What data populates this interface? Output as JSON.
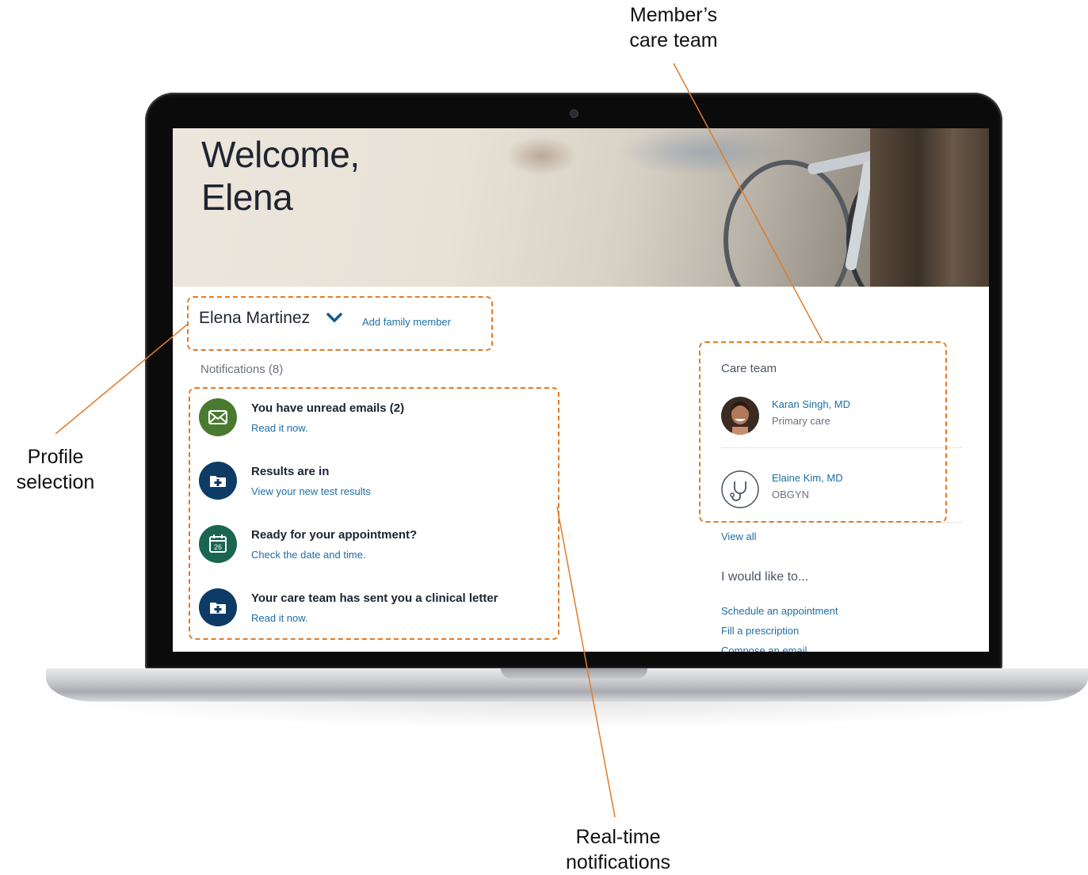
{
  "callouts": {
    "care_team": [
      "Member’s",
      "care team"
    ],
    "profile": [
      "Profile",
      "selection"
    ],
    "notifications": [
      "Real-time",
      "notifications"
    ]
  },
  "hero": {
    "welcome_line1": "Welcome,",
    "welcome_line2": "Elena"
  },
  "profile": {
    "name": "Elena Martinez",
    "add_family_label": "Add family member"
  },
  "notifications": {
    "header": "Notifications (8)",
    "items": [
      {
        "title": "You have unread emails (2)",
        "link": "Read it now.",
        "icon": "mail-icon",
        "color": "#4a7a2f"
      },
      {
        "title": "Results are in",
        "link": "View your new test results",
        "icon": "medical-folder-icon",
        "color": "#0d3b66"
      },
      {
        "title": "Ready for your appointment?",
        "link": "Check the date and time.",
        "icon": "calendar-icon",
        "color": "#1a6650"
      },
      {
        "title": "Your care team has sent you a clinical letter",
        "link": "Read it now.",
        "icon": "medical-folder-icon",
        "color": "#0d3b66"
      }
    ]
  },
  "care_team": {
    "header": "Care team",
    "doctors": [
      {
        "name": "Karan Singh, MD",
        "specialty": "Primary care",
        "avatar": "doctor-photo"
      },
      {
        "name": "Elaine Kim, MD",
        "specialty": "OBGYN",
        "avatar": "stethoscope-icon"
      }
    ],
    "view_all_label": "View all"
  },
  "actions": {
    "header": "I would like to...",
    "items": [
      "Schedule an appointment",
      "Fill a prescription",
      "Compose an email"
    ]
  },
  "colors": {
    "accent": "#e07b2a",
    "link": "#1d6fa5"
  }
}
